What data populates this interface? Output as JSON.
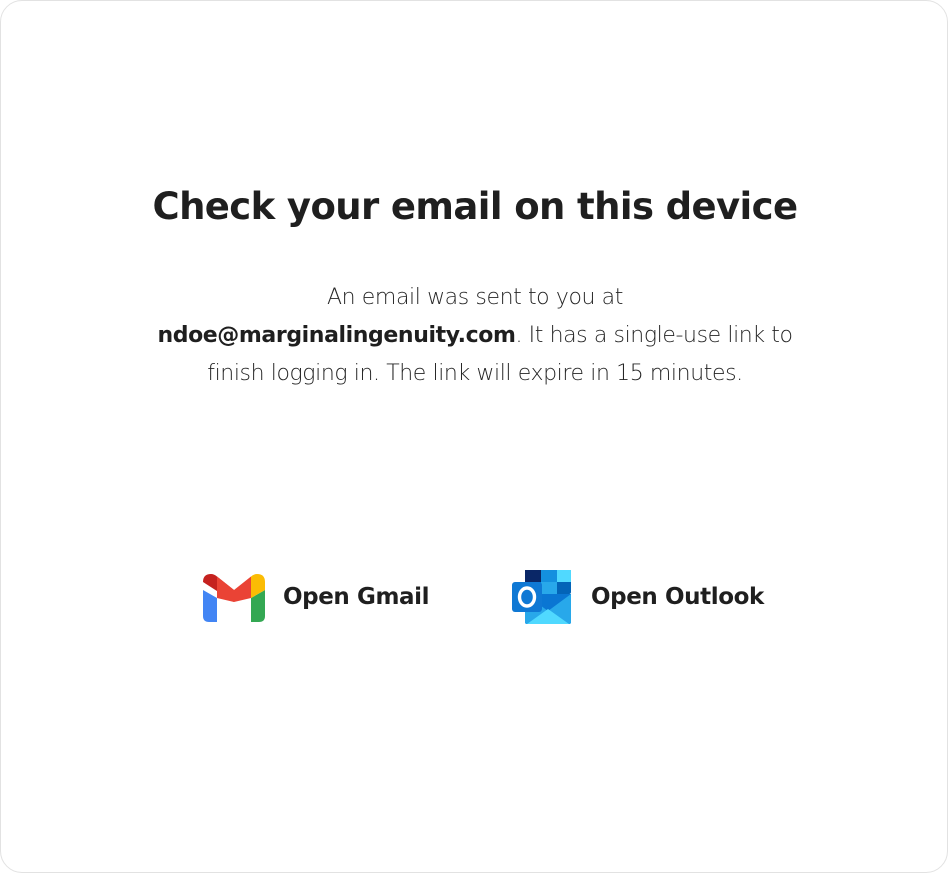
{
  "page": {
    "title": "Check your email on this device",
    "message": {
      "prefix": "An email was sent to you at ",
      "email": "ndoe@marginalingenuity.com",
      "suffix": ". It has a single-use link to finish logging in. The link will expire in 15 minutes."
    }
  },
  "actions": {
    "gmail": {
      "label": "Open Gmail",
      "icon": "gmail-icon"
    },
    "outlook": {
      "label": "Open Outlook",
      "icon": "outlook-icon"
    }
  },
  "colors": {
    "gmail_red": "#EA4335",
    "gmail_blue": "#4285F4",
    "gmail_green": "#34A853",
    "gmail_yellow": "#FBBC04",
    "outlook_blue": "#0364B8",
    "outlook_light": "#28A8EA"
  }
}
